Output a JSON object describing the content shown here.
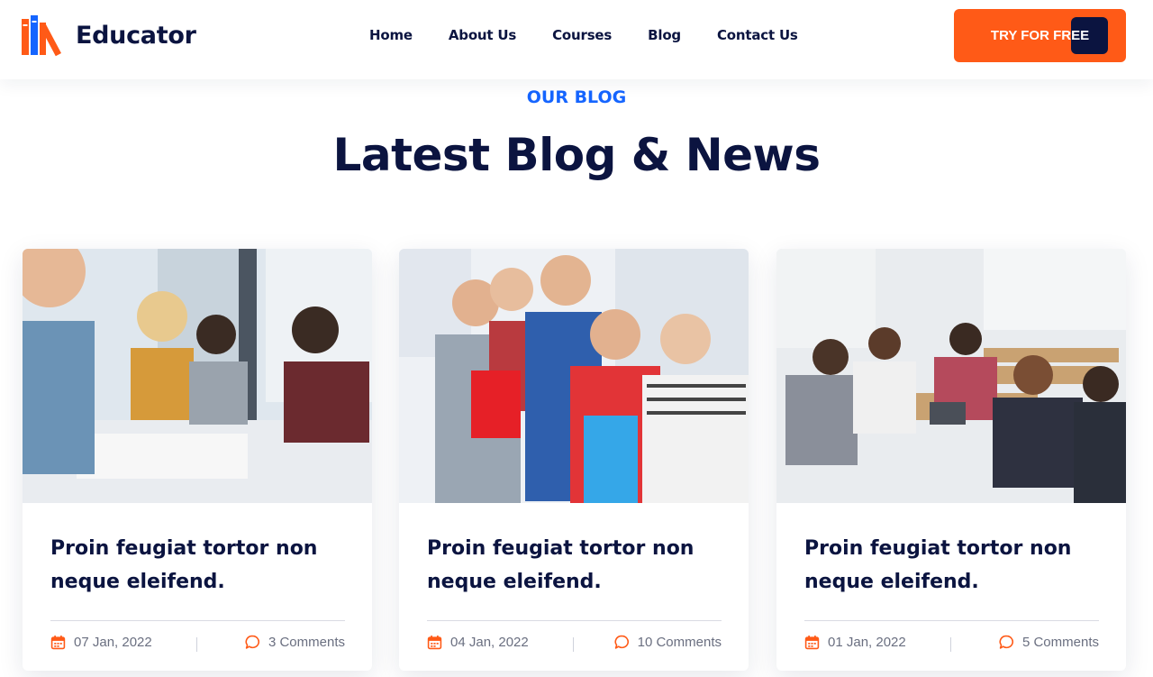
{
  "header": {
    "logo_text": "Educator",
    "nav": [
      "Home",
      "About Us",
      "Courses",
      "Blog",
      "Contact Us"
    ],
    "cta_label": "TRY FOR FREE"
  },
  "section": {
    "eyebrow": "OUR BLOG",
    "title": "Latest Blog & News"
  },
  "posts": [
    {
      "title": "Proin feugiat tortor non neque eleifend.",
      "date": "07 Jan, 2022",
      "comments": "3 Comments",
      "image": "students-studying-at-table-photo"
    },
    {
      "title": "Proin feugiat tortor non neque eleifend.",
      "date": "04 Jan, 2022",
      "comments": "10 Comments",
      "image": "happy-students-group-photo"
    },
    {
      "title": "Proin feugiat tortor non neque eleifend.",
      "date": "01 Jan, 2022",
      "comments": "5 Comments",
      "image": "students-in-classroom-photo"
    }
  ],
  "colors": {
    "accent_orange": "#ff5a17",
    "brand_navy": "#0b1440",
    "eyebrow_blue": "#1565ff"
  },
  "icons": {
    "date": "calendar-icon",
    "comments": "comment-bubble-icon"
  }
}
